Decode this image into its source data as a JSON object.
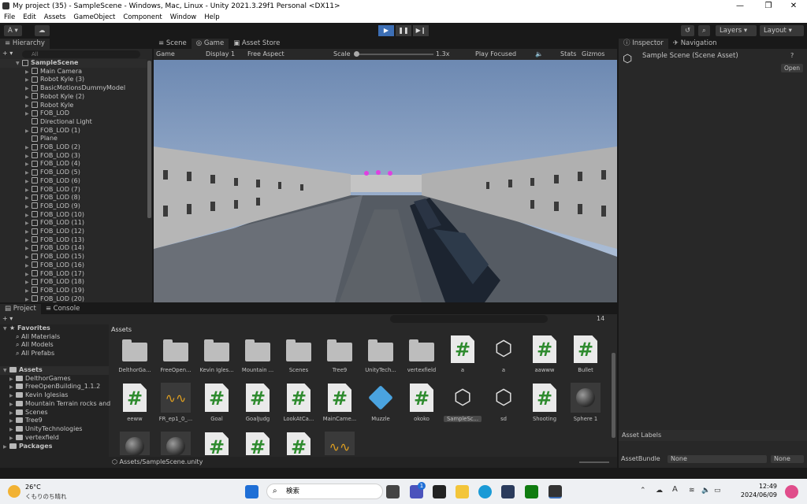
{
  "window": {
    "title": "My project (35) - SampleScene - Windows, Mac, Linux - Unity 2021.3.29f1 Personal <DX11>",
    "min": "—",
    "max": "❐",
    "close": "✕"
  },
  "menu": [
    "File",
    "Edit",
    "Assets",
    "GameObject",
    "Component",
    "Window",
    "Help"
  ],
  "toolbar": {
    "account": "A ▾",
    "cloud": "☁",
    "history": "↺",
    "search": "⌕",
    "layers": "Layers",
    "layout": "Layout"
  },
  "hierarchy": {
    "tab": "Hierarchy",
    "add": "+ ▾",
    "search_placeholder": "All",
    "scene": "SampleScene",
    "items": [
      "Main Camera",
      "Robot Kyle (3)",
      "BasicMotionsDummyModel",
      "Robot Kyle (2)",
      "Robot Kyle",
      "FOB_LOD",
      "Directional Light",
      "FOB_LOD (1)",
      "Plane",
      "FOB_LOD (2)",
      "FOB_LOD (3)",
      "FOB_LOD (4)",
      "FOB_LOD (5)",
      "FOB_LOD (6)",
      "FOB_LOD (7)",
      "FOB_LOD (8)",
      "FOB_LOD (9)",
      "FOB_LOD (10)",
      "FOB_LOD (11)",
      "FOB_LOD (12)",
      "FOB_LOD (13)",
      "FOB_LOD (14)",
      "FOB_LOD (15)",
      "FOB_LOD (16)",
      "FOB_LOD (17)",
      "FOB_LOD (18)",
      "FOB_LOD (19)",
      "FOB_LOD (20)"
    ]
  },
  "center_tabs": [
    "Scene",
    "Game",
    "Asset Store"
  ],
  "game_bar": {
    "mode": "Game",
    "display": "Display 1",
    "aspect": "Free Aspect",
    "scale_label": "Scale",
    "scale_value": "1.3x",
    "play_focus": "Play Focused",
    "stats": "Stats",
    "gizmos": "Gizmos"
  },
  "inspector": {
    "tabs": [
      "Inspector",
      "Navigation"
    ],
    "title": "Sample Scene (Scene Asset)",
    "open": "Open",
    "asset_labels": "Asset Labels",
    "bundle_label": "AssetBundle",
    "bundle_value": "None",
    "variant_value": "None"
  },
  "project": {
    "tabs": [
      "Project",
      "Console"
    ],
    "add": "+ ▾",
    "favorites": "Favorites",
    "fav_items": [
      "All Materials",
      "All Models",
      "All Prefabs"
    ],
    "assets_root": "Assets",
    "folders": [
      "DelthorGames",
      "FreeOpenBuilding_1.1.2",
      "Kevin Iglesias",
      "Mountain Terrain rocks and",
      "Scenes",
      "Tree9",
      "UnityTechnologies",
      "vertexfield"
    ],
    "packages": "Packages",
    "breadcrumb": "Assets",
    "hidden_count": "14",
    "path": "Assets/SampleScene.unity",
    "assets": [
      {
        "name": "DelthorGa...",
        "kind": "folder"
      },
      {
        "name": "FreeOpen...",
        "kind": "folder"
      },
      {
        "name": "Kevin Igles...",
        "kind": "folder"
      },
      {
        "name": "Mountain ...",
        "kind": "folder"
      },
      {
        "name": "Scenes",
        "kind": "folder"
      },
      {
        "name": "Tree9",
        "kind": "folder"
      },
      {
        "name": "UnityTech...",
        "kind": "folder"
      },
      {
        "name": "vertexfield",
        "kind": "folder"
      },
      {
        "name": "a",
        "kind": "script"
      },
      {
        "name": "a",
        "kind": "unity"
      },
      {
        "name": "aawww",
        "kind": "script"
      },
      {
        "name": "Bullet",
        "kind": "script"
      },
      {
        "name": "eeww",
        "kind": "script"
      },
      {
        "name": "FR_ep1_0_...",
        "kind": "audio"
      },
      {
        "name": "Goal",
        "kind": "script"
      },
      {
        "name": "GoalJudg",
        "kind": "script"
      },
      {
        "name": "LookAtCa...",
        "kind": "script"
      },
      {
        "name": "MainCame...",
        "kind": "script"
      },
      {
        "name": "Muzzle",
        "kind": "cube"
      },
      {
        "name": "okoko",
        "kind": "script"
      },
      {
        "name": "SampleSc...",
        "kind": "unity-selected"
      },
      {
        "name": "sd",
        "kind": "unity"
      },
      {
        "name": "Shooting",
        "kind": "script"
      },
      {
        "name": "Sphere 1",
        "kind": "material"
      },
      {
        "name": "",
        "kind": "material"
      },
      {
        "name": "",
        "kind": "material"
      },
      {
        "name": "",
        "kind": "script"
      },
      {
        "name": "",
        "kind": "script"
      },
      {
        "name": "",
        "kind": "script"
      },
      {
        "name": "",
        "kind": "audio"
      }
    ]
  },
  "taskbar": {
    "temp": "26°C",
    "weather": "くもりのち晴れ",
    "search": "検索",
    "time": "12:49",
    "date": "2024/06/09",
    "ime": "A",
    "badge": "1"
  },
  "colors": {
    "accent": "#3d6fb5",
    "panel": "#282828",
    "dark": "#191919"
  }
}
